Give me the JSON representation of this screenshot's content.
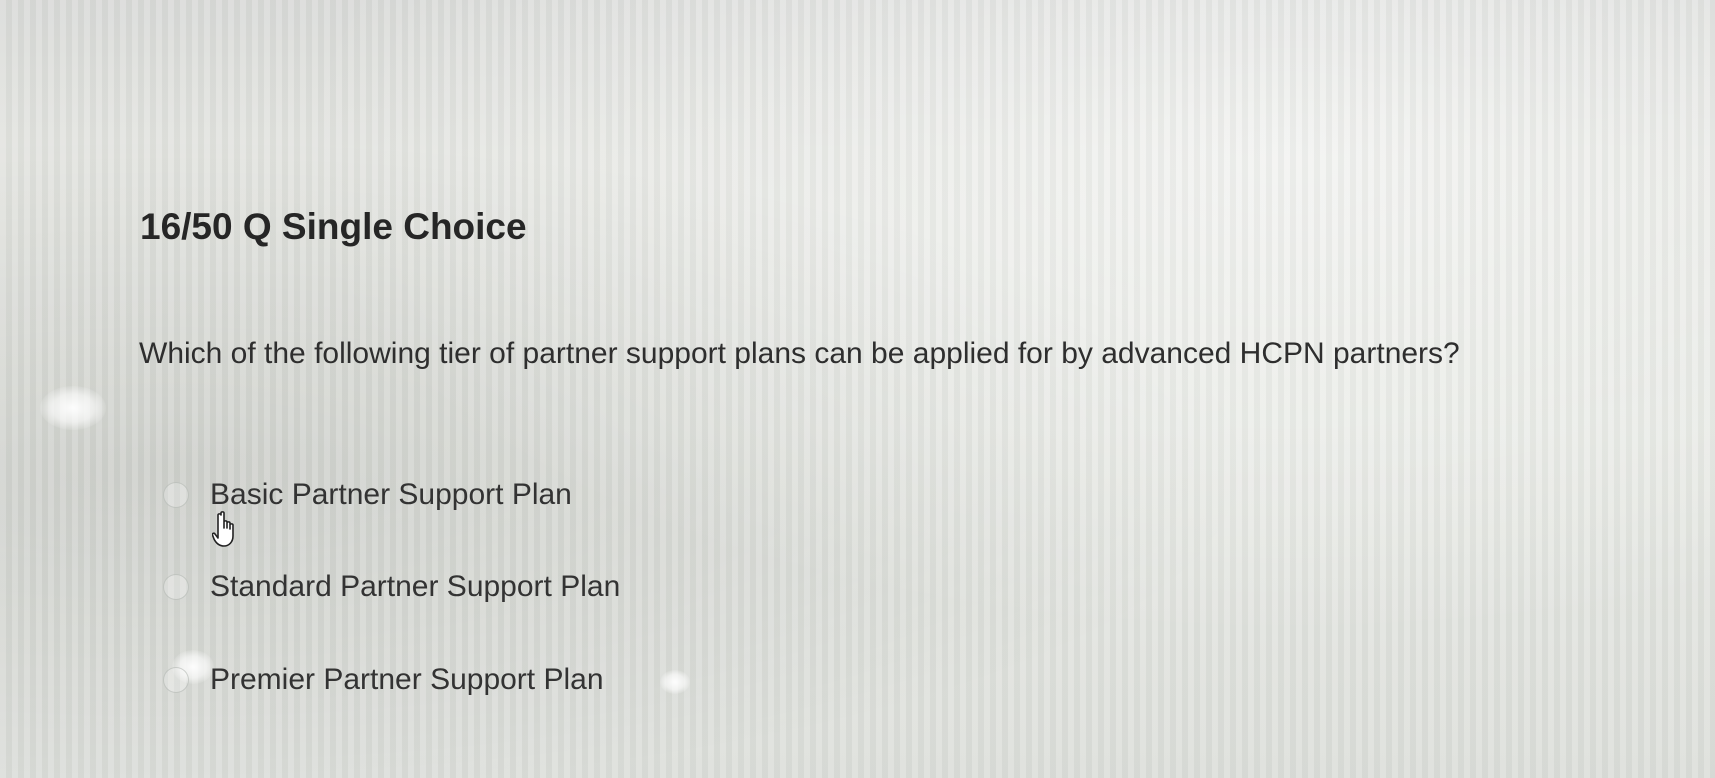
{
  "question": {
    "header": "16/50 Q Single Choice",
    "text": "Which of the following tier of partner support plans can be applied for by advanced HCPN partners?"
  },
  "options": [
    {
      "label": "Basic Partner Support Plan",
      "selected": false
    },
    {
      "label": "Standard Partner Support Plan",
      "selected": false
    },
    {
      "label": "Premier Partner Support Plan",
      "selected": false
    }
  ],
  "cursor": {
    "icon": "hand-pointer-icon"
  }
}
